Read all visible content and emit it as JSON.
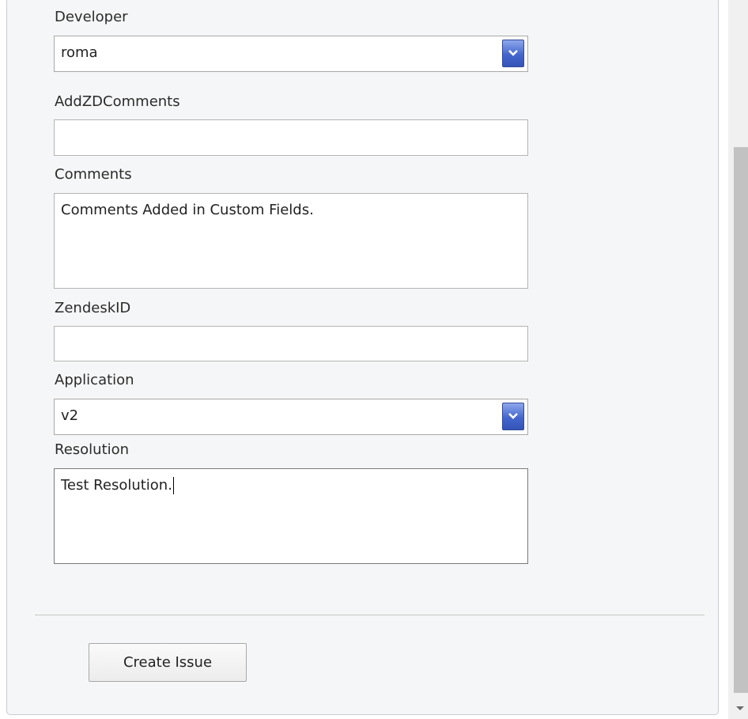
{
  "form": {
    "developer": {
      "label": "Developer",
      "value": "roma"
    },
    "add_zd_comments": {
      "label": "AddZDComments",
      "value": ""
    },
    "comments": {
      "label": "Comments",
      "value": "Comments Added in Custom Fields."
    },
    "zendesk_id": {
      "label": "ZendeskID",
      "value": ""
    },
    "application": {
      "label": "Application",
      "value": "v2"
    },
    "resolution": {
      "label": "Resolution",
      "value": "Test Resolution."
    }
  },
  "actions": {
    "create_issue_label": "Create Issue"
  },
  "icons": {
    "dropdown": "chevron-down-icon",
    "scroll_down": "scroll-down-arrow-icon"
  },
  "colors": {
    "dropdown_button": "#4466cc",
    "panel_background": "#f5f6f7",
    "scroll_thumb": "#c2c2c2"
  }
}
